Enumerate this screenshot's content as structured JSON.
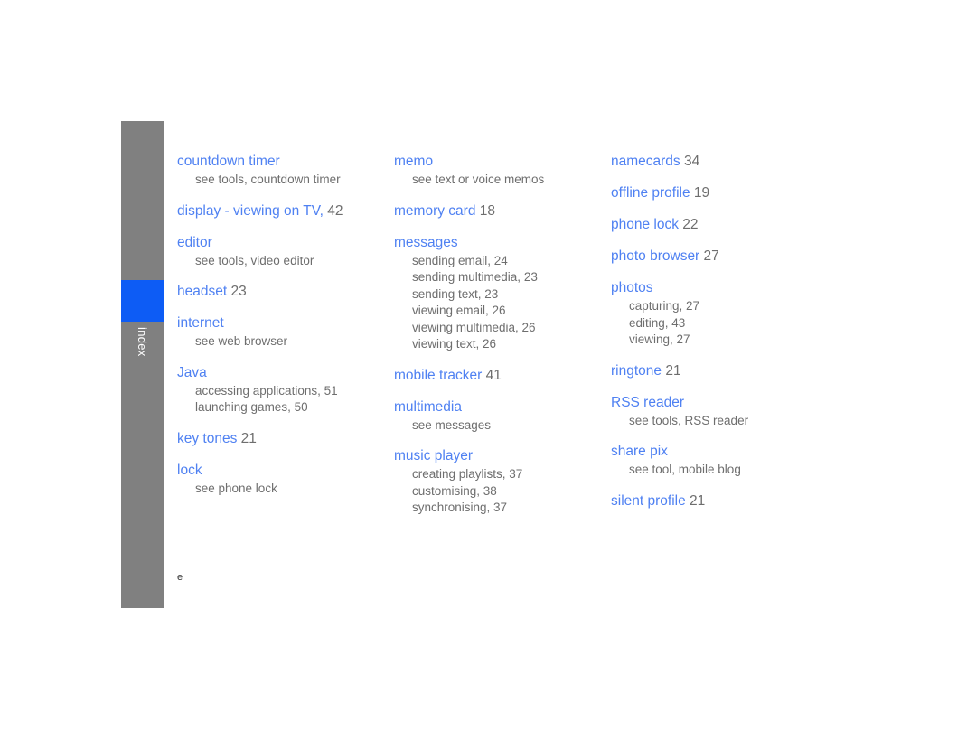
{
  "side_tab": {
    "label": "index",
    "bar_color": "#808080",
    "highlight_color": "#0d5cf5",
    "label_color": "#ffffff"
  },
  "theme": {
    "heading_color": "#4f81f2",
    "body_color": "#6e6e6e",
    "background": "#ffffff"
  },
  "footer": {
    "mark": "e"
  },
  "columns": [
    {
      "entries": [
        {
          "heading": "countdown timer",
          "page": "",
          "subs": [
            "see tools, countdown timer"
          ]
        },
        {
          "heading": "display - viewing on TV,",
          "page": "42",
          "subs": []
        },
        {
          "heading": "editor",
          "page": "",
          "subs": [
            "see tools, video editor"
          ]
        },
        {
          "heading": "headset",
          "page": "23",
          "subs": []
        },
        {
          "heading": "internet",
          "page": "",
          "subs": [
            "see web browser"
          ]
        },
        {
          "heading": "Java",
          "page": "",
          "subs": [
            "accessing applications, 51",
            "launching games, 50"
          ]
        },
        {
          "heading": "key tones",
          "page": "21",
          "subs": []
        },
        {
          "heading": "lock",
          "page": "",
          "subs": [
            "see phone lock"
          ]
        }
      ]
    },
    {
      "entries": [
        {
          "heading": "memo",
          "page": "",
          "subs": [
            "see text or voice memos"
          ]
        },
        {
          "heading": "memory card",
          "page": "18",
          "subs": []
        },
        {
          "heading": "messages",
          "page": "",
          "subs": [
            "sending email, 24",
            "sending multimedia, 23",
            "sending text, 23",
            "viewing email, 26",
            "viewing multimedia, 26",
            "viewing text, 26"
          ]
        },
        {
          "heading": "mobile tracker",
          "page": "41",
          "subs": []
        },
        {
          "heading": "multimedia",
          "page": "",
          "subs": [
            "see messages"
          ]
        },
        {
          "heading": "music player",
          "page": "",
          "subs": [
            "creating playlists, 37",
            "customising, 38",
            "synchronising, 37"
          ]
        }
      ]
    },
    {
      "entries": [
        {
          "heading": "namecards",
          "page": "34",
          "subs": []
        },
        {
          "heading": "offline profile",
          "page": "19",
          "subs": []
        },
        {
          "heading": "phone lock",
          "page": "22",
          "subs": []
        },
        {
          "heading": "photo browser",
          "page": "27",
          "subs": []
        },
        {
          "heading": "photos",
          "page": "",
          "subs": [
            "capturing, 27",
            "editing, 43",
            "viewing, 27"
          ]
        },
        {
          "heading": "ringtone",
          "page": "21",
          "subs": []
        },
        {
          "heading": "RSS reader",
          "page": "",
          "subs": [
            "see tools, RSS reader"
          ]
        },
        {
          "heading": "share pix",
          "page": "",
          "subs": [
            "see tool, mobile blog"
          ]
        },
        {
          "heading": "silent profile",
          "page": "21",
          "subs": []
        }
      ]
    }
  ]
}
